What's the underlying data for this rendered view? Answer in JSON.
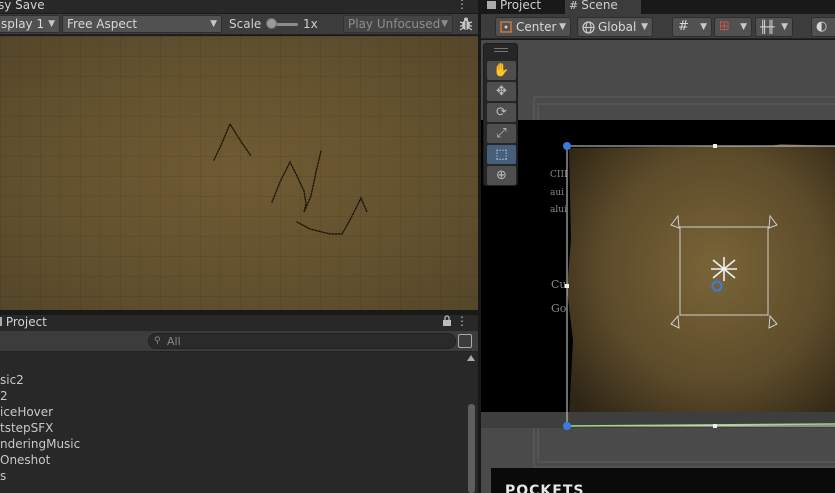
{
  "game": {
    "tab_title": "sy Save",
    "display": "splay 1",
    "aspect": "Free Aspect",
    "scale_label": "Scale",
    "scale_value": "1x",
    "play_mode": "Play Unfocused",
    "bug_icon": "bug-icon",
    "menu_icon": "kebab-menu-icon"
  },
  "project": {
    "tab_title": "Project",
    "search_placeholder": "All",
    "items": [
      "sic2",
      "2",
      "iceHover",
      "tstepSFX",
      "nderingMusic",
      "Oneshot",
      "s"
    ]
  },
  "scene": {
    "tabs": [
      "Project",
      "Scene"
    ],
    "pivot_mode": "Center",
    "pivot_rotation": "Global",
    "tools": [
      "hand-tool",
      "move-tool",
      "rotate-tool",
      "scale-tool",
      "rect-tool",
      "transform-tool"
    ],
    "active_tool": "rect-tool",
    "bottom_text": "POCKETS",
    "sidebar_text": [
      "CIII",
      "aui",
      "alui",
      "Cu",
      "Go"
    ]
  },
  "colors": {
    "accent_blue": "#46607c",
    "parchment": "#6f5b33",
    "handle_blue": "#3b7be0",
    "rect_outline": "#c8c8c8"
  }
}
